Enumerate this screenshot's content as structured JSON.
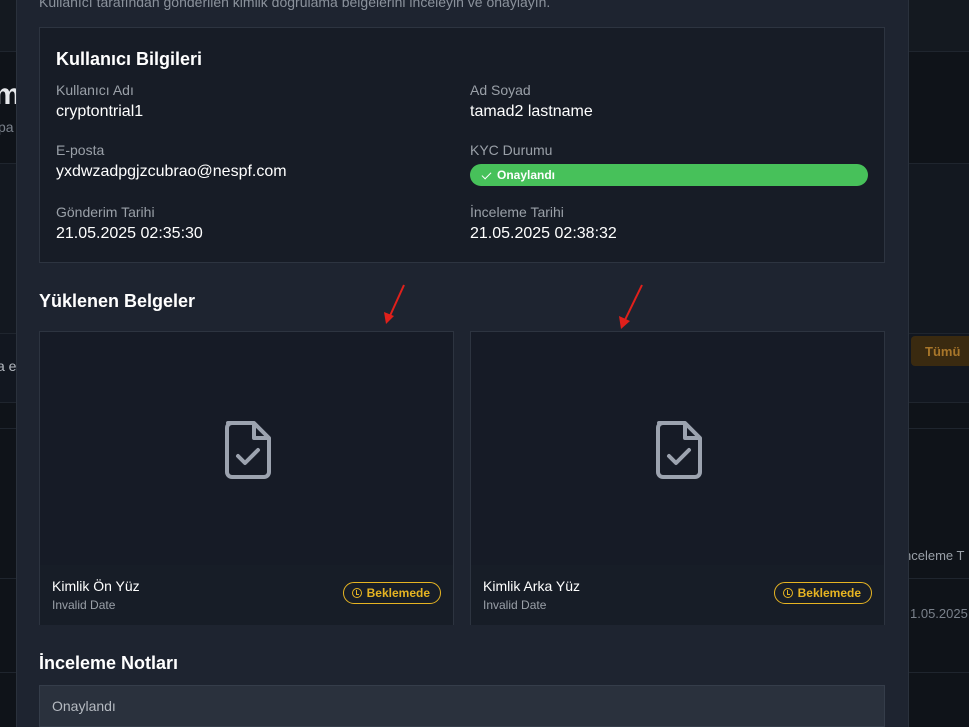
{
  "background": {
    "left_title": "m",
    "left_sub": "pa",
    "left_e": "a e",
    "filter_button": "Tümü",
    "col_header": "nceleme T",
    "row_date": "1.05.2025"
  },
  "modal": {
    "description": "Kullanıcı tarafından gönderilen kimlik doğrulama belgelerini inceleyin ve onaylayın.",
    "user_info": {
      "title": "Kullanıcı Bilgileri",
      "username_label": "Kullanıcı Adı",
      "username": "cryptontrial1",
      "fullname_label": "Ad Soyad",
      "fullname": "tamad2 lastname",
      "email_label": "E-posta",
      "email": "yxdwzadpgjzcubrao@nespf.com",
      "kyc_label": "KYC Durumu",
      "kyc_status": "Onaylandı",
      "submitted_label": "Gönderim Tarihi",
      "submitted": "21.05.2025 02:35:30",
      "reviewed_label": "İnceleme Tarihi",
      "reviewed": "21.05.2025 02:38:32"
    },
    "documents": {
      "title": "Yüklenen Belgeler",
      "items": [
        {
          "name": "Kimlik Ön Yüz",
          "date": "Invalid Date",
          "status": "Beklemede",
          "icon": "file-check-icon"
        },
        {
          "name": "Kimlik Arka Yüz",
          "date": "Invalid Date",
          "status": "Beklemede",
          "icon": "file-check-icon"
        }
      ]
    },
    "notes": {
      "title": "İnceleme Notları",
      "value": "Onaylandı"
    }
  },
  "colors": {
    "success": "#47c15a",
    "pending": "#e6b422",
    "annotation_arrow": "#e0201b"
  }
}
